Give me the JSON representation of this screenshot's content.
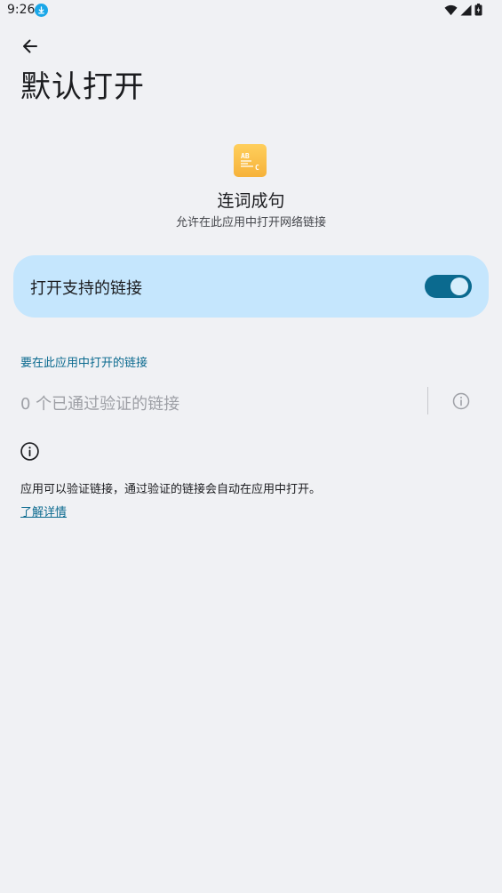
{
  "status_bar": {
    "time": "9:26",
    "icons": [
      "download-icon",
      "wifi-icon",
      "signal-icon",
      "battery-charging-icon"
    ]
  },
  "header": {
    "back_icon": "arrow-back-icon",
    "title": "默认打开"
  },
  "app": {
    "icon_text": "AB C",
    "name": "连词成句",
    "subtitle": "允许在此应用中打开网络链接"
  },
  "toggle": {
    "label": "打开支持的链接",
    "checked": true
  },
  "links_section": {
    "header": "要在此应用中打开的链接",
    "verified_links": "0 个已通过验证的链接",
    "info_icon": "info-icon"
  },
  "footer": {
    "info_icon": "info-icon",
    "text": "应用可以验证链接，通过验证的链接会自动在应用中打开。",
    "learn_more": "了解详情"
  },
  "colors": {
    "background": "#f0f1f4",
    "accent": "#0b6a8f",
    "card": "#c5e6fd",
    "app_icon": "#f6b23a"
  }
}
